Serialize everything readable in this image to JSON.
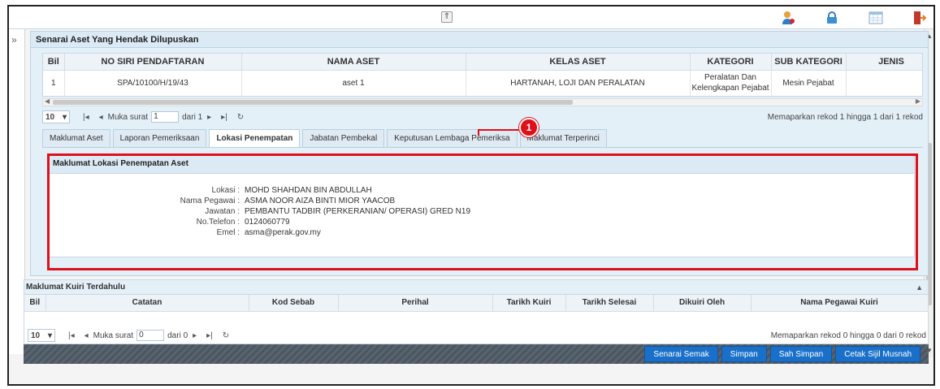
{
  "topbar": {
    "collapse_symbol": "⇑",
    "icons": [
      "user-icon",
      "lock-icon",
      "calendar-icon",
      "logout-icon"
    ]
  },
  "rail": {
    "toggle": "»"
  },
  "panel1": {
    "title": "Senarai Aset Yang Hendak Dilupuskan",
    "columns": [
      "Bil",
      "NO SIRI PENDAFTARAN",
      "NAMA ASET",
      "KELAS ASET",
      "KATEGORI",
      "SUB KATEGORI",
      "JENIS"
    ],
    "row": {
      "bil": "1",
      "no_siri": "SPA/10100/H/19/43",
      "nama": "aset 1",
      "kelas": "HARTANAH, LOJI DAN PERALATAN",
      "kategori_line1": "Peralatan Dan",
      "kategori_line2": "Kelengkapan Pejabat",
      "sub_kategori": "Mesin Pejabat",
      "jenis": ""
    },
    "pager": {
      "page_size": "10",
      "muka_surat_label": "Muka surat",
      "page": "1",
      "of_label": "dari 1",
      "info": "Memaparkan rekod 1 hingga 1 dari 1 rekod"
    },
    "tabs": [
      "Maklumat Aset",
      "Laporan Pemeriksaan",
      "Lokasi Penempatan",
      "Jabatan Pembekal",
      "Keputusan Lembaga Pemeriksa",
      "Maklumat Terperinci"
    ],
    "active_tab": "Lokasi Penempatan"
  },
  "detail": {
    "title": "Maklumat Lokasi Penempatan Aset",
    "fields": [
      {
        "label": "Lokasi :",
        "value": "MOHD SHAHDAN BIN ABDULLAH"
      },
      {
        "label": "Nama Pegawai :",
        "value": "ASMA NOOR AIZA BINTI MIOR YAACOB"
      },
      {
        "label": "Jawatan :",
        "value": "PEMBANTU TADBIR (PERKERANIAN/ OPERASI) GRED N19"
      },
      {
        "label": "No.Telefon :",
        "value": "0124060779"
      },
      {
        "label": "Emel :",
        "value": "asma@perak.gov.my"
      }
    ]
  },
  "callout": {
    "number": "1",
    "color": "#e0101a"
  },
  "panel2": {
    "title": "Maklumat Kuiri Terdahulu",
    "columns": [
      "Bil",
      "Catatan",
      "Kod Sebab",
      "Perihal",
      "Tarikh Kuiri",
      "Tarikh Selesai",
      "Dikuiri Oleh",
      "Nama Pegawai Kuiri"
    ],
    "pager": {
      "page_size": "10",
      "muka_surat_label": "Muka surat",
      "page": "0",
      "of_label": "dari 0",
      "info": "Memaparkan rekod 0 hingga 0 dari 0 rekod"
    }
  },
  "actions": {
    "senarai_semak": "Senarai Semak",
    "simpan": "Simpan",
    "sah_simpan": "Sah Simpan",
    "cetak": "Cetak Sijil Musnah"
  }
}
